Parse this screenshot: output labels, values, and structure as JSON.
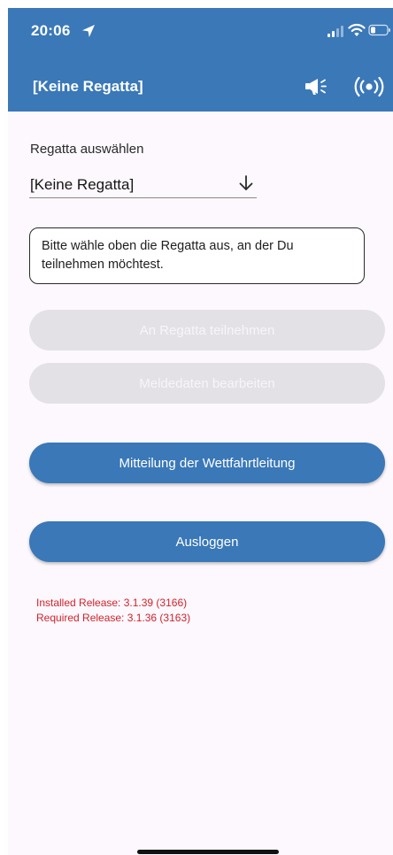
{
  "status_bar": {
    "time": "20:06",
    "location_icon": "location-arrow-icon",
    "signal_icon": "cellular-signal-icon",
    "wifi_icon": "wifi-icon",
    "battery_icon": "battery-icon"
  },
  "app_bar": {
    "title": "[Keine Regatta]",
    "actions": [
      "megaphone-icon",
      "broadcast-icon"
    ]
  },
  "regatta_select": {
    "label": "Regatta auswählen",
    "selected_value": "[Keine Regatta]",
    "icon": "arrow-down-icon"
  },
  "info_message": "Bitte wähle oben die Regatta aus, an der Du teilnehmen möchtest.",
  "buttons": {
    "join_regatta": "An Regatta teilnehmen",
    "edit_registration": "Meldedaten bearbeiten",
    "race_committee_notice": "Mitteilung der Wettfahrtleitung",
    "logout": "Ausloggen"
  },
  "release_info": {
    "installed": "Installed Release: 3.1.39 (3166)",
    "required": "Required Release: 3.1.36 (3163)"
  },
  "colors": {
    "primary": "#3a78b8",
    "disabled_button": "#e3e1e5",
    "release_text": "#d3222b",
    "background": "#fcf8fd"
  }
}
